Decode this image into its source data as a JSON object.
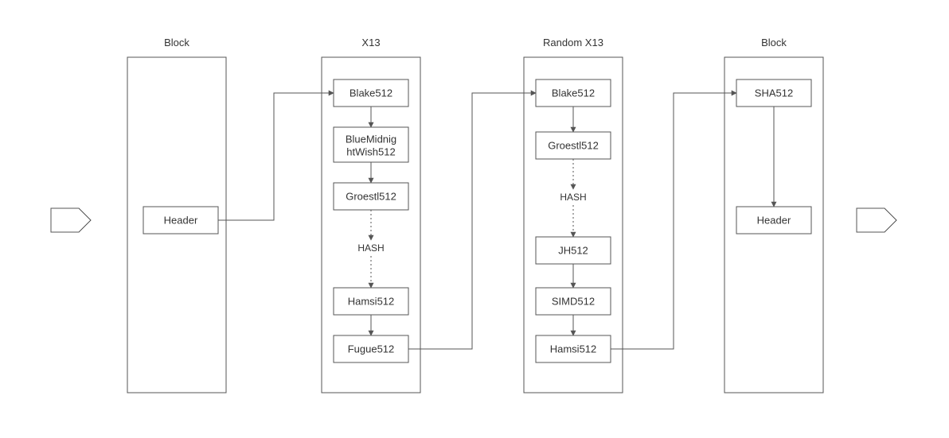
{
  "columns": {
    "c1": {
      "title": "Block",
      "nodes": {
        "header": "Header"
      }
    },
    "c2": {
      "title": "X13",
      "nodes": {
        "blake": "Blake512",
        "bmw1": "BlueMidnig",
        "bmw2": "htWish512",
        "groestl": "Groestl512",
        "hamsi": "Hamsi512",
        "fugue": "Fugue512"
      },
      "hash_label": "HASH"
    },
    "c3": {
      "title": "Random X13",
      "nodes": {
        "blake": "Blake512",
        "groestl": "Groestl512",
        "jh": "JH512",
        "simd": "SIMD512",
        "hamsi": "Hamsi512"
      },
      "hash_label": "HASH"
    },
    "c4": {
      "title": "Block",
      "nodes": {
        "sha": "SHA512",
        "header": "Header"
      }
    }
  }
}
